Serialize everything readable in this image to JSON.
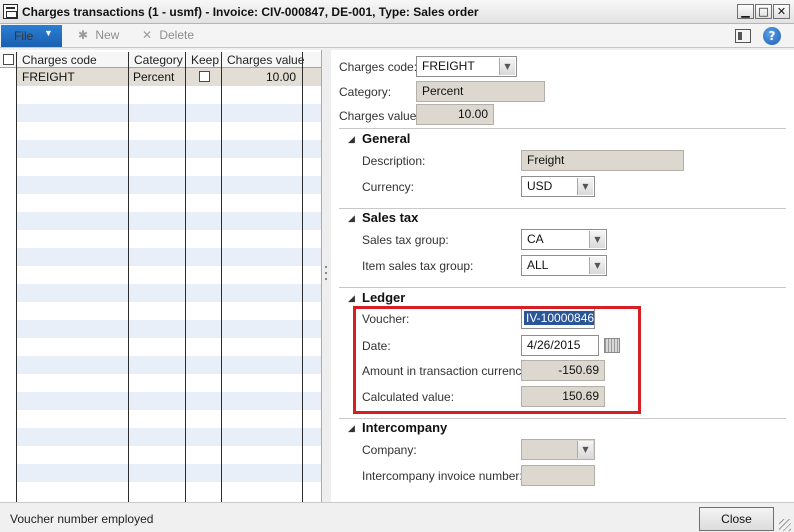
{
  "window": {
    "title": "Charges transactions (1 - usmf) - Invoice: CIV-000847, DE-001, Type: Sales order",
    "minimize_glyph": "▁",
    "maximize_glyph": "□",
    "close_glyph": "✕"
  },
  "toolbar": {
    "file_label": "File",
    "file_caret": "▼",
    "new_label": "New",
    "new_icon": "✱",
    "delete_label": "Delete",
    "delete_icon": "✕",
    "help_glyph": "?"
  },
  "grid": {
    "columns": [
      "Charges code",
      "Category",
      "Keep",
      "Charges value"
    ],
    "rows": [
      {
        "charges_code": "FREIGHT",
        "category": "Percent",
        "keep": false,
        "charges_value": "10.00"
      }
    ]
  },
  "header_fields": {
    "charges_code_label": "Charges code:",
    "charges_code_value": "FREIGHT",
    "category_label": "Category:",
    "category_value": "Percent",
    "charges_value_label": "Charges value:",
    "charges_value_value": "10.00"
  },
  "general": {
    "title": "General",
    "description_label": "Description:",
    "description_value": "Freight",
    "currency_label": "Currency:",
    "currency_value": "USD"
  },
  "sales_tax": {
    "title": "Sales tax",
    "group_label": "Sales tax group:",
    "group_value": "CA",
    "item_group_label": "Item sales tax group:",
    "item_group_value": "ALL"
  },
  "ledger": {
    "title": "Ledger",
    "voucher_label": "Voucher:",
    "voucher_value": "IV-10000846",
    "date_label": "Date:",
    "date_value": "4/26/2015",
    "amount_label": "Amount in transaction currency:",
    "amount_value": "-150.69",
    "calculated_label": "Calculated value:",
    "calculated_value": "150.69"
  },
  "intercompany": {
    "title": "Intercompany",
    "company_label": "Company:",
    "company_value": "",
    "invoice_number_label": "Intercompany invoice number:",
    "invoice_number_value": ""
  },
  "status": {
    "message": "Voucher number employed",
    "close_label": "Close"
  },
  "colors": {
    "file_button": "#1b5fb0",
    "highlight_box": "#d81e25",
    "field_background": "#dcd7cf",
    "row_stripe": "#e9eff8"
  }
}
